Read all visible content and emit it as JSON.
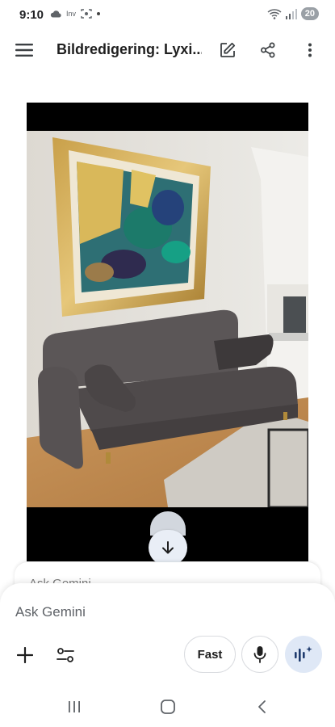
{
  "status_bar": {
    "time": "9:10",
    "carrier_label": "Inv",
    "battery": "20"
  },
  "app_bar": {
    "title": "Bildredigering: Lyxi..."
  },
  "icons": {
    "menu": "menu-icon",
    "edit": "edit-icon",
    "share": "share-icon",
    "more": "more-vert-icon",
    "scroll_down": "arrow-down-icon",
    "plus": "plus-icon",
    "tools": "tune-icon",
    "mic": "mic-icon",
    "live": "live-sparkle-icon"
  },
  "peek": {
    "text": "Ask Gemini"
  },
  "composer": {
    "placeholder": "Ask Gemini",
    "mode_label": "Fast"
  },
  "colors": {
    "accent_light": "#dfe8f6",
    "border": "#dadce0",
    "text": "#1f1f1f"
  }
}
